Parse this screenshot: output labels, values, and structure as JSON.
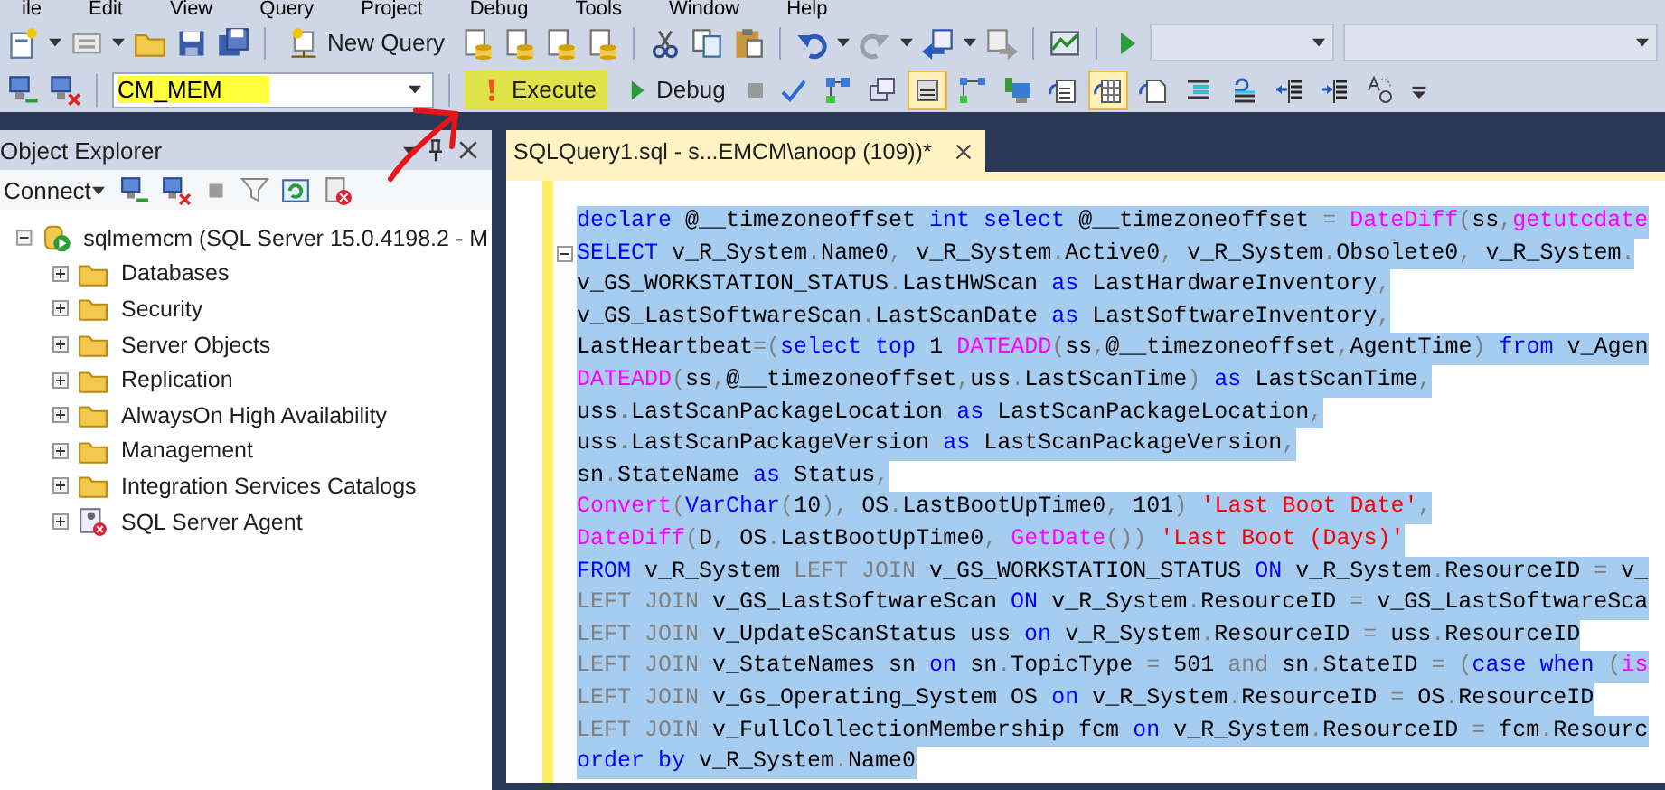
{
  "menu": [
    "ile",
    "Edit",
    "View",
    "Query",
    "Project",
    "Debug",
    "Tools",
    "Window",
    "Help"
  ],
  "toolbar": {
    "new_query": "New Query",
    "database": {
      "value": "CM_MEM",
      "highlighted": true
    },
    "execute": {
      "label": "Execute",
      "highlighted": true
    },
    "debug": "Debug",
    "query_buttons": [
      {
        "kind": "diagram",
        "on": false
      },
      {
        "kind": "windows",
        "on": false
      },
      {
        "kind": "list",
        "on": true
      },
      {
        "kind": "connector",
        "on": false
      },
      {
        "kind": "monitor",
        "on": false
      },
      {
        "kind": "text-doc",
        "on": false
      },
      {
        "kind": "grid-doc",
        "on": true
      },
      {
        "kind": "file-doc",
        "on": false
      },
      {
        "kind": "comment",
        "on": false
      },
      {
        "kind": "uncomment",
        "on": false
      },
      {
        "kind": "outdent",
        "on": false
      },
      {
        "kind": "indent",
        "on": false
      },
      {
        "kind": "replace",
        "on": false
      }
    ]
  },
  "object_explorer": {
    "title": "Object Explorer",
    "connect": "Connect",
    "tree": [
      {
        "label": "sqlmemcm (SQL Server 15.0.4198.2 - M",
        "kind": "server",
        "expanded": true,
        "children": [
          {
            "label": "Databases",
            "kind": "folder",
            "expanded": false
          },
          {
            "label": "Security",
            "kind": "folder",
            "expanded": false
          },
          {
            "label": "Server Objects",
            "kind": "folder",
            "expanded": false
          },
          {
            "label": "Replication",
            "kind": "folder",
            "expanded": false
          },
          {
            "label": "AlwaysOn High Availability",
            "kind": "folder",
            "expanded": false
          },
          {
            "label": "Management",
            "kind": "folder",
            "expanded": false
          },
          {
            "label": "Integration Services Catalogs",
            "kind": "folder",
            "expanded": false
          },
          {
            "label": "SQL Server Agent",
            "kind": "agent",
            "expanded": false
          }
        ]
      }
    ]
  },
  "editor": {
    "tab": {
      "title": "SQLQuery1.sql - s...EMCM\\anoop (109))*",
      "selected": true
    },
    "lines": [
      {
        "selected": true,
        "tokens": [
          {
            "kind": "keyword",
            "text": "declare"
          },
          {
            "kind": "plain",
            "text": " @__timezoneoffset "
          },
          {
            "kind": "keyword",
            "text": "int select"
          },
          {
            "kind": "plain",
            "text": " @__timezoneoffset "
          },
          {
            "kind": "operator",
            "text": "="
          },
          {
            "kind": "function",
            "text": " DateDiff"
          },
          {
            "kind": "operator",
            "text": "("
          },
          {
            "kind": "plain",
            "text": "ss"
          },
          {
            "kind": "operator",
            "text": ","
          },
          {
            "kind": "function",
            "text": "getutcdate"
          }
        ]
      },
      {
        "selected": true,
        "fold": true,
        "tokens": [
          {
            "kind": "keyword",
            "text": "SELECT"
          },
          {
            "kind": "plain",
            "text": " v_R_System"
          },
          {
            "kind": "operator",
            "text": "."
          },
          {
            "kind": "plain",
            "text": "Name0"
          },
          {
            "kind": "operator",
            "text": ","
          },
          {
            "kind": "plain",
            "text": " v_R_System"
          },
          {
            "kind": "operator",
            "text": "."
          },
          {
            "kind": "plain",
            "text": "Active0"
          },
          {
            "kind": "operator",
            "text": ","
          },
          {
            "kind": "plain",
            "text": " v_R_System"
          },
          {
            "kind": "operator",
            "text": "."
          },
          {
            "kind": "plain",
            "text": "Obsolete0"
          },
          {
            "kind": "operator",
            "text": ","
          },
          {
            "kind": "plain",
            "text": " v_R_System"
          },
          {
            "kind": "operator",
            "text": "."
          }
        ]
      },
      {
        "selected": true,
        "tokens": [
          {
            "kind": "plain",
            "text": "v_GS_WORKSTATION_STATUS"
          },
          {
            "kind": "operator",
            "text": "."
          },
          {
            "kind": "plain",
            "text": "LastHWScan "
          },
          {
            "kind": "keyword",
            "text": "as"
          },
          {
            "kind": "plain",
            "text": " LastHardwareInventory"
          },
          {
            "kind": "operator",
            "text": ","
          }
        ]
      },
      {
        "selected": true,
        "tokens": [
          {
            "kind": "plain",
            "text": "v_GS_LastSoftwareScan"
          },
          {
            "kind": "operator",
            "text": "."
          },
          {
            "kind": "plain",
            "text": "LastScanDate "
          },
          {
            "kind": "keyword",
            "text": "as"
          },
          {
            "kind": "plain",
            "text": " LastSoftwareInventory"
          },
          {
            "kind": "operator",
            "text": ","
          }
        ]
      },
      {
        "selected": true,
        "tokens": [
          {
            "kind": "plain",
            "text": "LastHeartbeat"
          },
          {
            "kind": "operator",
            "text": "=("
          },
          {
            "kind": "keyword",
            "text": "select top"
          },
          {
            "kind": "plain",
            "text": " 1 "
          },
          {
            "kind": "function",
            "text": "DATEADD"
          },
          {
            "kind": "operator",
            "text": "("
          },
          {
            "kind": "plain",
            "text": "ss"
          },
          {
            "kind": "operator",
            "text": ","
          },
          {
            "kind": "plain",
            "text": "@__timezoneoffset"
          },
          {
            "kind": "operator",
            "text": ","
          },
          {
            "kind": "plain",
            "text": "AgentTime"
          },
          {
            "kind": "operator",
            "text": ")"
          },
          {
            "kind": "keyword",
            "text": " from"
          },
          {
            "kind": "plain",
            "text": " v_Agen"
          }
        ]
      },
      {
        "selected": true,
        "tokens": [
          {
            "kind": "function",
            "text": "DATEADD"
          },
          {
            "kind": "operator",
            "text": "("
          },
          {
            "kind": "plain",
            "text": "ss"
          },
          {
            "kind": "operator",
            "text": ","
          },
          {
            "kind": "plain",
            "text": "@__timezoneoffset"
          },
          {
            "kind": "operator",
            "text": ","
          },
          {
            "kind": "plain",
            "text": "uss"
          },
          {
            "kind": "operator",
            "text": "."
          },
          {
            "kind": "plain",
            "text": "LastScanTime"
          },
          {
            "kind": "operator",
            "text": ")"
          },
          {
            "kind": "keyword",
            "text": " as"
          },
          {
            "kind": "plain",
            "text": " LastScanTime"
          },
          {
            "kind": "operator",
            "text": ","
          }
        ]
      },
      {
        "selected": true,
        "tokens": [
          {
            "kind": "plain",
            "text": "uss"
          },
          {
            "kind": "operator",
            "text": "."
          },
          {
            "kind": "plain",
            "text": "LastScanPackageLocation "
          },
          {
            "kind": "keyword",
            "text": "as"
          },
          {
            "kind": "plain",
            "text": " LastScanPackageLocation"
          },
          {
            "kind": "operator",
            "text": ","
          }
        ]
      },
      {
        "selected": true,
        "tokens": [
          {
            "kind": "plain",
            "text": "uss"
          },
          {
            "kind": "operator",
            "text": "."
          },
          {
            "kind": "plain",
            "text": "LastScanPackageVersion "
          },
          {
            "kind": "keyword",
            "text": "as"
          },
          {
            "kind": "plain",
            "text": " LastScanPackageVersion"
          },
          {
            "kind": "operator",
            "text": ","
          }
        ]
      },
      {
        "selected": true,
        "tokens": [
          {
            "kind": "plain",
            "text": "sn"
          },
          {
            "kind": "operator",
            "text": "."
          },
          {
            "kind": "plain",
            "text": "StateName "
          },
          {
            "kind": "keyword",
            "text": "as"
          },
          {
            "kind": "plain",
            "text": " Status"
          },
          {
            "kind": "operator",
            "text": ","
          }
        ]
      },
      {
        "selected": true,
        "tokens": [
          {
            "kind": "function",
            "text": "Convert"
          },
          {
            "kind": "operator",
            "text": "("
          },
          {
            "kind": "keyword",
            "text": "VarChar"
          },
          {
            "kind": "operator",
            "text": "("
          },
          {
            "kind": "plain",
            "text": "10"
          },
          {
            "kind": "operator",
            "text": "),"
          },
          {
            "kind": "plain",
            "text": " OS"
          },
          {
            "kind": "operator",
            "text": "."
          },
          {
            "kind": "plain",
            "text": "LastBootUpTime0"
          },
          {
            "kind": "operator",
            "text": ","
          },
          {
            "kind": "plain",
            "text": " 101"
          },
          {
            "kind": "operator",
            "text": ")"
          },
          {
            "kind": "string",
            "text": " 'Last Boot Date'"
          },
          {
            "kind": "operator",
            "text": ","
          }
        ]
      },
      {
        "selected": true,
        "tokens": [
          {
            "kind": "function",
            "text": "DateDiff"
          },
          {
            "kind": "operator",
            "text": "("
          },
          {
            "kind": "plain",
            "text": "D"
          },
          {
            "kind": "operator",
            "text": ","
          },
          {
            "kind": "plain",
            "text": " OS"
          },
          {
            "kind": "operator",
            "text": "."
          },
          {
            "kind": "plain",
            "text": "LastBootUpTime0"
          },
          {
            "kind": "operator",
            "text": ","
          },
          {
            "kind": "function",
            "text": " GetDate"
          },
          {
            "kind": "operator",
            "text": "())"
          },
          {
            "kind": "string",
            "text": " 'Last Boot (Days)'"
          }
        ]
      },
      {
        "selected": true,
        "tokens": [
          {
            "kind": "keyword",
            "text": "FROM"
          },
          {
            "kind": "plain",
            "text": " v_R_System "
          },
          {
            "kind": "operator",
            "text": "LEFT JOIN"
          },
          {
            "kind": "plain",
            "text": " v_GS_WORKSTATION_STATUS "
          },
          {
            "kind": "keyword",
            "text": "ON"
          },
          {
            "kind": "plain",
            "text": " v_R_System"
          },
          {
            "kind": "operator",
            "text": "."
          },
          {
            "kind": "plain",
            "text": "ResourceID "
          },
          {
            "kind": "operator",
            "text": "="
          },
          {
            "kind": "plain",
            "text": " v_"
          }
        ]
      },
      {
        "selected": true,
        "tokens": [
          {
            "kind": "operator",
            "text": "LEFT JOIN"
          },
          {
            "kind": "plain",
            "text": " v_GS_LastSoftwareScan "
          },
          {
            "kind": "keyword",
            "text": "ON"
          },
          {
            "kind": "plain",
            "text": " v_R_System"
          },
          {
            "kind": "operator",
            "text": "."
          },
          {
            "kind": "plain",
            "text": "ResourceID "
          },
          {
            "kind": "operator",
            "text": "="
          },
          {
            "kind": "plain",
            "text": " v_GS_LastSoftwareSca"
          }
        ]
      },
      {
        "selected": true,
        "tokens": [
          {
            "kind": "operator",
            "text": "LEFT JOIN"
          },
          {
            "kind": "plain",
            "text": " v_UpdateScanStatus uss "
          },
          {
            "kind": "keyword",
            "text": "on"
          },
          {
            "kind": "plain",
            "text": " v_R_System"
          },
          {
            "kind": "operator",
            "text": "."
          },
          {
            "kind": "plain",
            "text": "ResourceID "
          },
          {
            "kind": "operator",
            "text": "="
          },
          {
            "kind": "plain",
            "text": " uss"
          },
          {
            "kind": "operator",
            "text": "."
          },
          {
            "kind": "plain",
            "text": "ResourceID"
          }
        ]
      },
      {
        "selected": true,
        "tokens": [
          {
            "kind": "operator",
            "text": "LEFT JOIN"
          },
          {
            "kind": "plain",
            "text": " v_StateNames sn "
          },
          {
            "kind": "keyword",
            "text": "on"
          },
          {
            "kind": "plain",
            "text": " sn"
          },
          {
            "kind": "operator",
            "text": "."
          },
          {
            "kind": "plain",
            "text": "TopicType "
          },
          {
            "kind": "operator",
            "text": "="
          },
          {
            "kind": "plain",
            "text": " 501 "
          },
          {
            "kind": "operator",
            "text": "and"
          },
          {
            "kind": "plain",
            "text": " sn"
          },
          {
            "kind": "operator",
            "text": "."
          },
          {
            "kind": "plain",
            "text": "StateID "
          },
          {
            "kind": "operator",
            "text": "= ("
          },
          {
            "kind": "keyword",
            "text": "case when"
          },
          {
            "kind": "operator",
            "text": " ("
          },
          {
            "kind": "function",
            "text": "is"
          }
        ]
      },
      {
        "selected": true,
        "tokens": [
          {
            "kind": "operator",
            "text": "LEFT JOIN"
          },
          {
            "kind": "plain",
            "text": " v_Gs_Operating_System OS "
          },
          {
            "kind": "keyword",
            "text": "on"
          },
          {
            "kind": "plain",
            "text": " v_R_System"
          },
          {
            "kind": "operator",
            "text": "."
          },
          {
            "kind": "plain",
            "text": "ResourceID "
          },
          {
            "kind": "operator",
            "text": "="
          },
          {
            "kind": "plain",
            "text": " OS"
          },
          {
            "kind": "operator",
            "text": "."
          },
          {
            "kind": "plain",
            "text": "ResourceID"
          }
        ]
      },
      {
        "selected": true,
        "tokens": [
          {
            "kind": "operator",
            "text": "LEFT JOIN"
          },
          {
            "kind": "plain",
            "text": " v_FullCollectionMembership fcm "
          },
          {
            "kind": "keyword",
            "text": "on"
          },
          {
            "kind": "plain",
            "text": " v_R_System"
          },
          {
            "kind": "operator",
            "text": "."
          },
          {
            "kind": "plain",
            "text": "ResourceID "
          },
          {
            "kind": "operator",
            "text": "="
          },
          {
            "kind": "plain",
            "text": " fcm"
          },
          {
            "kind": "operator",
            "text": "."
          },
          {
            "kind": "plain",
            "text": "Resourc"
          }
        ]
      },
      {
        "selected": true,
        "tokens": [
          {
            "kind": "keyword",
            "text": "order by"
          },
          {
            "kind": "plain",
            "text": " v_R_System"
          },
          {
            "kind": "operator",
            "text": "."
          },
          {
            "kind": "plain",
            "text": "Name0"
          }
        ]
      }
    ]
  }
}
